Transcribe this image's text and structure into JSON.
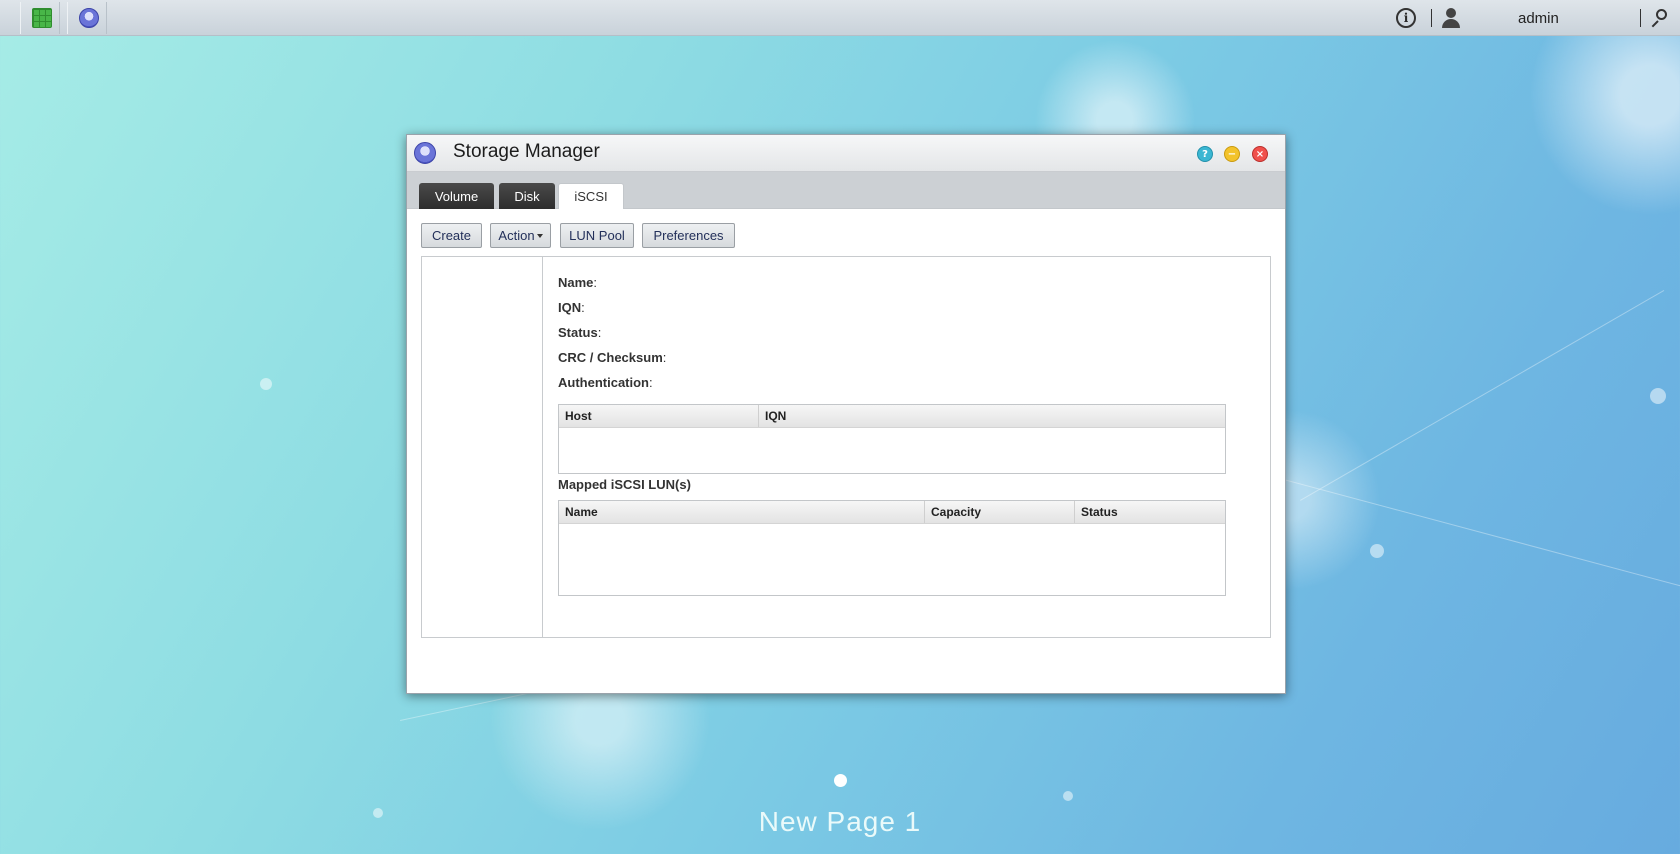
{
  "topbar": {
    "apps": [
      {
        "name": "main-menu",
        "icon": "grid-icon"
      },
      {
        "name": "storage-manager",
        "icon": "storage-manager-icon"
      }
    ],
    "info_icon": "info-icon",
    "user_icon": "user-icon",
    "username": "admin",
    "search_icon": "search-icon"
  },
  "window": {
    "title": "Storage Manager",
    "controls": {
      "help": "?",
      "minimize": "−",
      "close": "×"
    },
    "tabs": [
      {
        "label": "Volume",
        "active": false
      },
      {
        "label": "Disk",
        "active": false
      },
      {
        "label": "iSCSI",
        "active": true
      }
    ],
    "toolbar": {
      "create": "Create",
      "action": "Action",
      "lun_pool": "LUN Pool",
      "preferences": "Preferences"
    },
    "details": {
      "name_label": "Name",
      "iqn_label": "IQN",
      "status_label": "Status",
      "crc_label": "CRC / Checksum",
      "auth_label": "Authentication",
      "colon": ":"
    },
    "hosts_table": {
      "columns": [
        "Host",
        "IQN"
      ],
      "rows": []
    },
    "luns_title": "Mapped iSCSI LUN(s)",
    "luns_table": {
      "columns": [
        "Name",
        "Capacity",
        "Status"
      ],
      "rows": []
    }
  },
  "desktop": {
    "page_label": "New Page 1"
  },
  "colors": {
    "accent_dark_tab": "#2d2d2d",
    "help": "#3ab6d2",
    "minimize": "#f3c32b",
    "close": "#f0504c"
  }
}
